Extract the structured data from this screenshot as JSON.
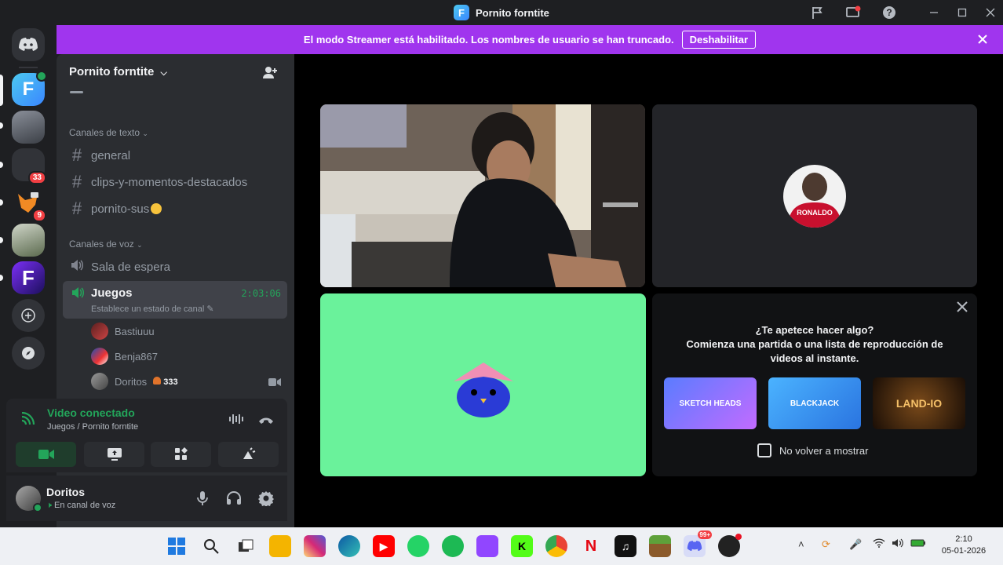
{
  "window": {
    "title": "Pornito forntite",
    "app_icon_letter": "F"
  },
  "banner": {
    "text": "El modo Streamer está habilitado. Los nombres de usuario se han truncado.",
    "button": "Deshabilitar",
    "background": "#a035ee"
  },
  "rail": {
    "badges": [
      "33",
      "9"
    ]
  },
  "sidebar": {
    "server_name": "Pornito forntite",
    "text_category": "Canales de texto",
    "text_channels": [
      "general",
      "clips-y-momentos-destacados",
      "pornito-sus"
    ],
    "voice_category": "Canales de voz",
    "voice_channels": [
      {
        "name": "Sala de espera"
      },
      {
        "name": "Juegos",
        "timer": "2:03:06",
        "status": "Establece un estado de canal"
      }
    ],
    "members": [
      {
        "name": "Bastiuuu"
      },
      {
        "name": "Benja867"
      },
      {
        "name": "Doritos",
        "extra": "333"
      }
    ]
  },
  "voice_panel": {
    "status": "Video conectado",
    "location": "Juegos / Pornito forntite",
    "accent": "#23a55a"
  },
  "user_panel": {
    "name": "Doritos",
    "status": "En canal de voz"
  },
  "call": {
    "tile_avatar_text": "RONALDO",
    "activity": {
      "title": "¿Te apetece hacer algo?",
      "subtitle": "Comienza una partida o una lista de reproducción de videos al instante.",
      "games": [
        "SKETCH HEADS",
        "BLACKJACK",
        "LAND-IO"
      ],
      "checkbox_label": "No volver a mostrar"
    },
    "green_tile_color": "#6af29b"
  },
  "taskbar": {
    "time": "2:10",
    "date": "05-01-2026",
    "badge": "99+"
  }
}
